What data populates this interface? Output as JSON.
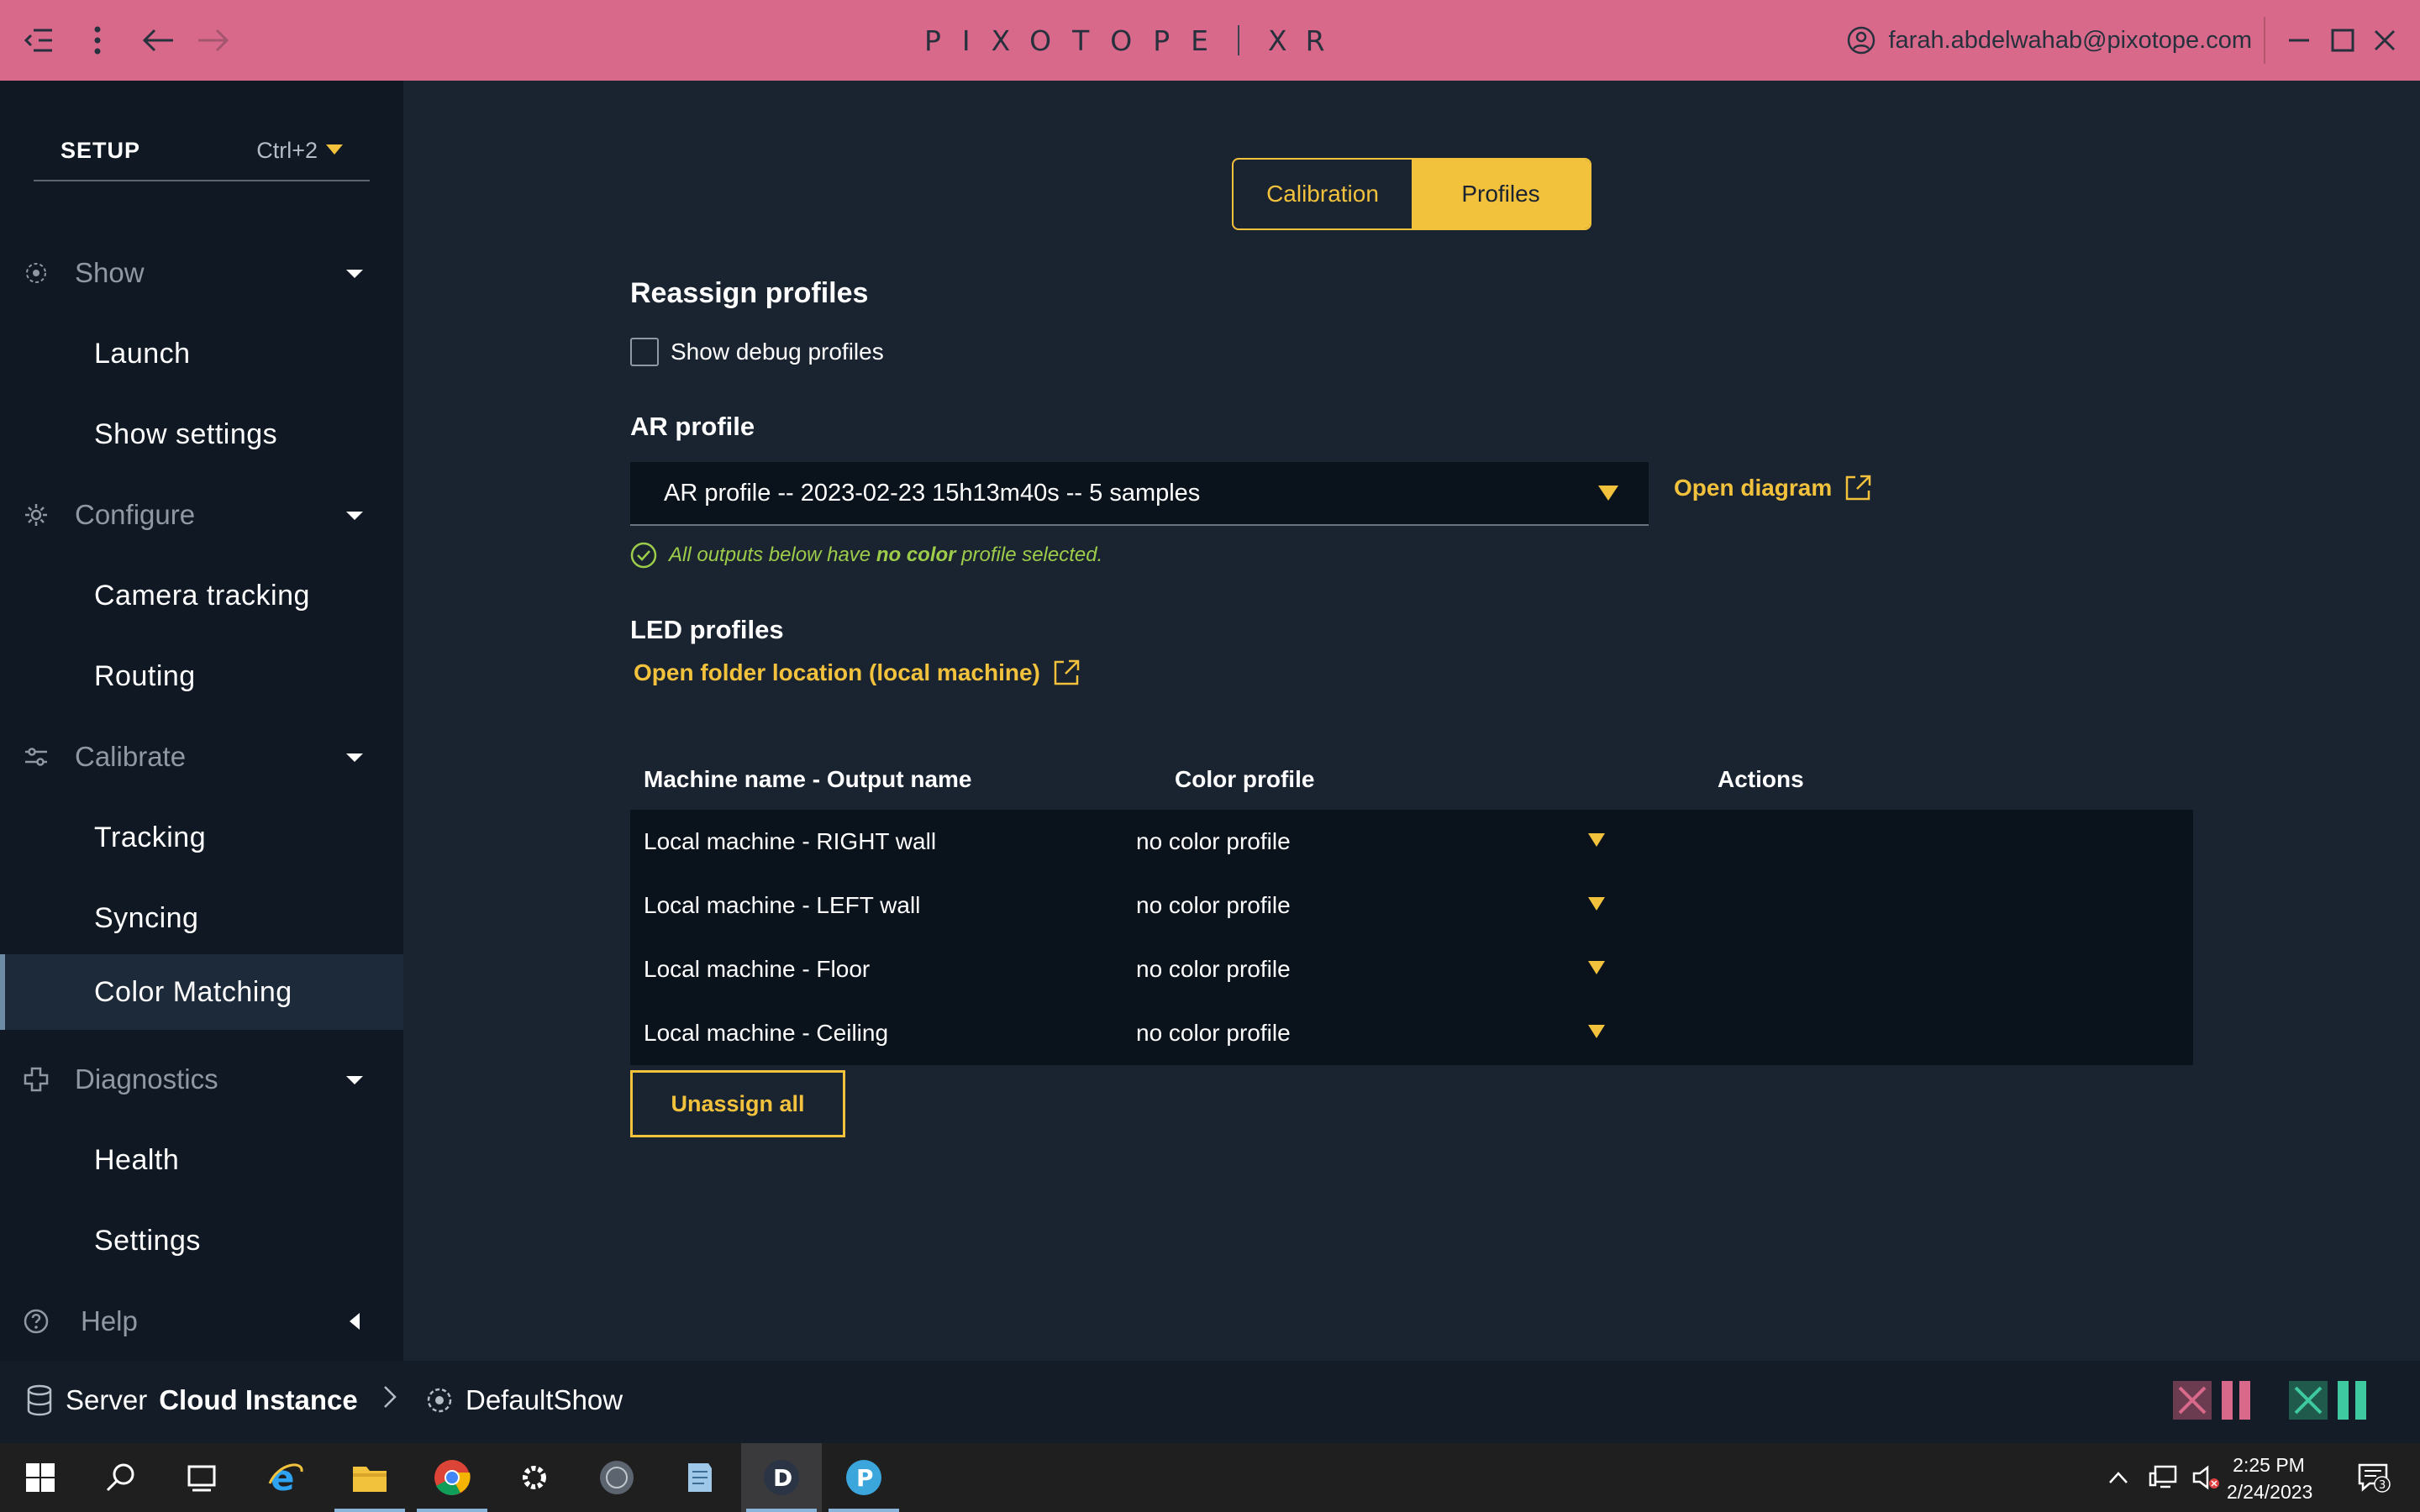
{
  "titlebar": {
    "logo_text": "PIXOTOPE",
    "product": "XR",
    "user_email": "farah.abdelwahab@pixotope.com"
  },
  "sidebar": {
    "setup_label": "SETUP",
    "setup_shortcut": "Ctrl+2",
    "groups": [
      {
        "label": "Show",
        "icon": "show-icon",
        "items": [
          "Launch",
          "Show settings"
        ]
      },
      {
        "label": "Configure",
        "icon": "gear-icon",
        "items": [
          "Camera tracking",
          "Routing"
        ]
      },
      {
        "label": "Calibrate",
        "icon": "sliders-icon",
        "items": [
          "Tracking",
          "Syncing",
          "Color Matching"
        ]
      },
      {
        "label": "Diagnostics",
        "icon": "diagnostics-icon",
        "items": [
          "Health",
          "Settings"
        ]
      },
      {
        "label": "Help",
        "icon": "help-icon",
        "items": []
      }
    ],
    "active_item": "Color Matching"
  },
  "main": {
    "tabs": [
      {
        "label": "Calibration",
        "active": false
      },
      {
        "label": "Profiles",
        "active": true
      }
    ],
    "reassign_title": "Reassign profiles",
    "show_debug_label": "Show debug profiles",
    "show_debug_checked": false,
    "ar_profile_title": "AR profile",
    "ar_profile_value": "AR profile -- 2023-02-23 15h13m40s -- 5 samples",
    "open_diagram_label": "Open diagram",
    "status_prefix": "All outputs below have ",
    "status_bold": "no color",
    "status_suffix": " profile selected.",
    "led_profiles_title": "LED profiles",
    "open_folder_label": "Open folder location (local machine)",
    "table": {
      "headers": [
        "Machine name - Output name",
        "Color profile",
        "Actions"
      ],
      "rows": [
        {
          "name": "Local machine - RIGHT wall",
          "profile": "no color profile"
        },
        {
          "name": "Local machine - LEFT wall",
          "profile": "no color profile"
        },
        {
          "name": "Local machine - Floor",
          "profile": "no color profile"
        },
        {
          "name": "Local machine - Ceiling",
          "profile": "no color profile"
        }
      ]
    },
    "unassign_label": "Unassign all"
  },
  "statusbar": {
    "server_label": "Server",
    "server_name": "Cloud Instance",
    "show_name": "DefaultShow"
  },
  "taskbar": {
    "time": "2:25 PM",
    "date": "2/24/2023",
    "notification_count": "3"
  },
  "colors": {
    "accent": "#f2c23d",
    "titlebar": "#d9698a",
    "success": "#9ccc4a",
    "indicator_pink": "#d9698a",
    "indicator_green": "#3ec9a0"
  }
}
